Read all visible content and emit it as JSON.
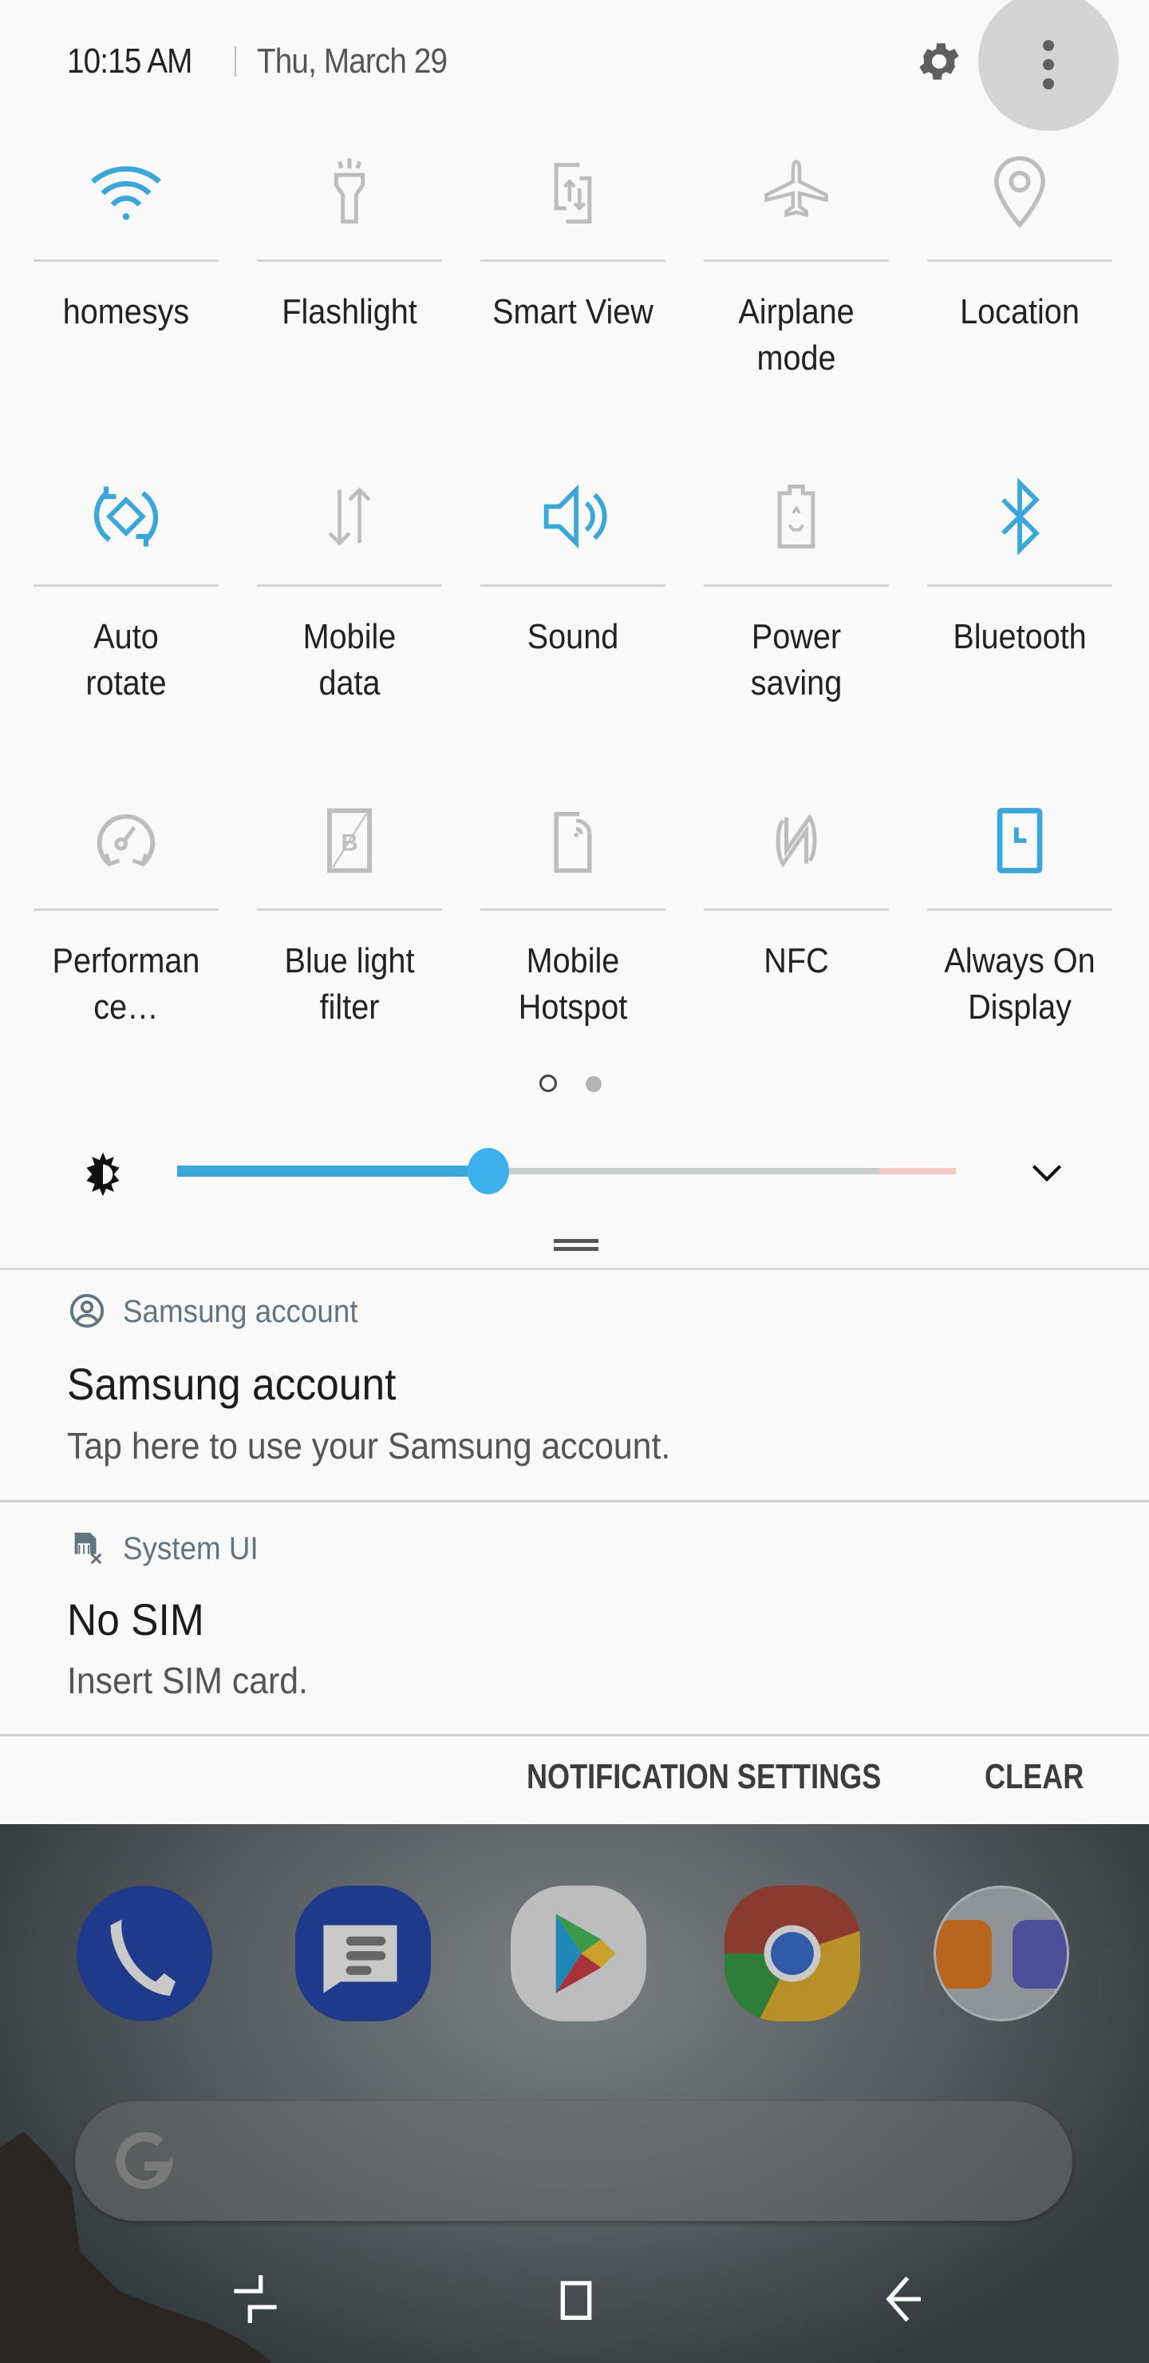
{
  "status": {
    "time": "10:15 AM",
    "date": "Thu, March 29",
    "settings_icon": "gear-icon",
    "more_icon": "more-vert-icon"
  },
  "quick_settings": {
    "page_count": 2,
    "current_page": 1,
    "tiles": [
      {
        "label_lines": [
          "homesys"
        ],
        "icon": "wifi-icon",
        "active": true
      },
      {
        "label_lines": [
          "Flashlight"
        ],
        "icon": "flashlight-icon",
        "active": false
      },
      {
        "label_lines": [
          "Smart View"
        ],
        "icon": "smart-view-icon",
        "active": false
      },
      {
        "label_lines": [
          "Airplane",
          "mode"
        ],
        "icon": "airplane-icon",
        "active": false
      },
      {
        "label_lines": [
          "Location"
        ],
        "icon": "location-pin-icon",
        "active": false
      },
      {
        "label_lines": [
          "Auto",
          "rotate"
        ],
        "icon": "auto-rotate-icon",
        "active": true
      },
      {
        "label_lines": [
          "Mobile",
          "data"
        ],
        "icon": "mobile-data-icon",
        "active": false
      },
      {
        "label_lines": [
          "Sound"
        ],
        "icon": "sound-icon",
        "active": true
      },
      {
        "label_lines": [
          "Power",
          "saving"
        ],
        "icon": "power-saving-icon",
        "active": false
      },
      {
        "label_lines": [
          "Bluetooth"
        ],
        "icon": "bluetooth-icon",
        "active": true
      },
      {
        "label_lines": [
          "Performan",
          "ce…"
        ],
        "icon": "performance-icon",
        "active": false
      },
      {
        "label_lines": [
          "Blue light",
          "filter"
        ],
        "icon": "blue-light-filter-icon",
        "active": false
      },
      {
        "label_lines": [
          "Mobile",
          "Hotspot"
        ],
        "icon": "hotspot-icon",
        "active": false
      },
      {
        "label_lines": [
          "NFC"
        ],
        "icon": "nfc-icon",
        "active": false
      },
      {
        "label_lines": [
          "Always On",
          "Display"
        ],
        "icon": "always-on-display-icon",
        "active": true
      }
    ]
  },
  "brightness": {
    "level_percent": 40,
    "icon": "brightness-icon",
    "expand_icon": "chevron-down-icon"
  },
  "notifications": [
    {
      "app": "Samsung account",
      "app_icon": "account-circle-icon",
      "title": "Samsung account",
      "body": "Tap here to use your Samsung account."
    },
    {
      "app": "System UI",
      "app_icon": "no-sim-icon",
      "title": "No SIM",
      "body": "Insert SIM card."
    }
  ],
  "actions": {
    "settings_label": "NOTIFICATION SETTINGS",
    "clear_label": "CLEAR"
  },
  "colors": {
    "accent": "#3aa6d9",
    "inactive_icon": "#bdbdbd",
    "panel_bg": "#f9f9f9"
  },
  "home": {
    "dock": [
      "Phone",
      "Messages",
      "Play Store",
      "Chrome",
      "Samsung folder"
    ],
    "search_icon": "google-g-icon",
    "nav": [
      "recents-icon",
      "home-icon",
      "back-icon"
    ]
  }
}
